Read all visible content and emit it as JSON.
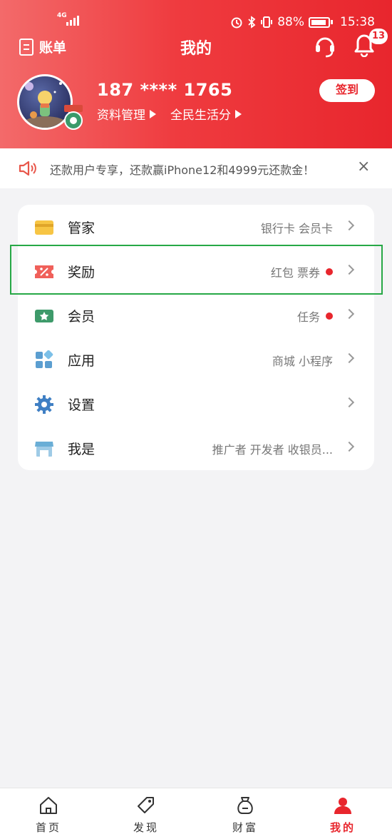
{
  "status": {
    "network": "4G",
    "battery": "88%",
    "time": "15:38"
  },
  "nav": {
    "bill_label": "账单",
    "title": "我的",
    "notification_count": "13"
  },
  "profile": {
    "phone": "187 **** 1765",
    "link1": "资料管理",
    "link2": "全民生活分",
    "signin": "签到"
  },
  "notice": {
    "text": "还款用户专享，还款赢iPhone12和4999元还款金！",
    "close": "×"
  },
  "menu": [
    {
      "label": "管家",
      "detail": "银行卡 会员卡"
    },
    {
      "label": "奖励",
      "detail": "红包 票券"
    },
    {
      "label": "会员",
      "detail": "任务"
    },
    {
      "label": "应用",
      "detail": "商城 小程序"
    },
    {
      "label": "设置",
      "detail": ""
    },
    {
      "label": "我是",
      "detail": "推广者 开发者 收银员..."
    }
  ],
  "tabs": [
    {
      "label": "首页"
    },
    {
      "label": "发现"
    },
    {
      "label": "财富"
    },
    {
      "label": "我的"
    }
  ],
  "colors": {
    "brand_red": "#e8262d",
    "highlight_green": "#27a846"
  }
}
